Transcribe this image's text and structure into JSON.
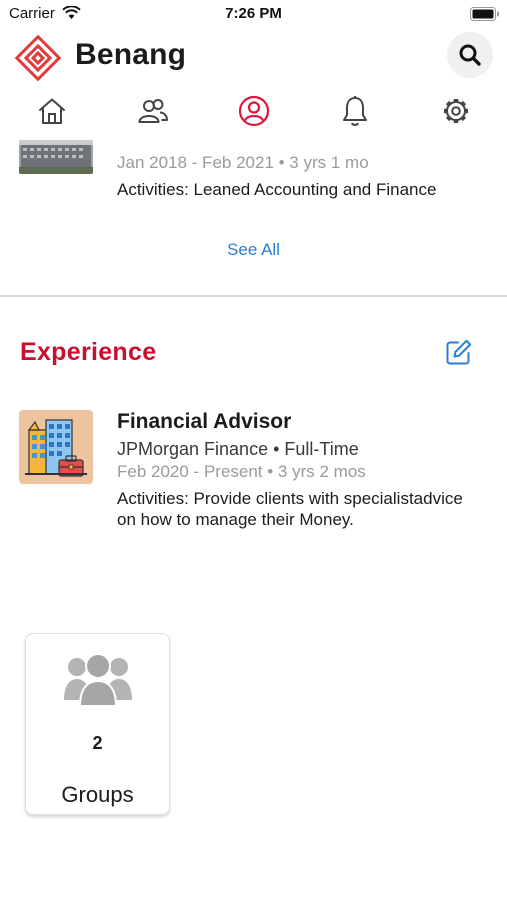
{
  "status_bar": {
    "carrier": "Carrier",
    "time": "7:26 PM"
  },
  "header": {
    "brand": "Benang",
    "search_icon": "search-icon",
    "logo_color": "#e23b3b"
  },
  "nav": {
    "items": [
      {
        "icon": "home-icon",
        "active": false
      },
      {
        "icon": "people-icon",
        "active": false
      },
      {
        "icon": "profile-icon",
        "active": true
      },
      {
        "icon": "bell-icon",
        "active": false
      },
      {
        "icon": "gear-icon",
        "active": false
      }
    ],
    "active_color": "#d81b3c",
    "inactive_color": "#444444"
  },
  "education": {
    "dates": "Jan 2018 - Feb 2021 • 3 yrs 1 mo",
    "activities": "Activities: Leaned Accounting and Finance",
    "see_all": "See All"
  },
  "experience": {
    "section_title": "Experience",
    "accent_color": "#c8102e",
    "edit_icon": "edit-icon",
    "job": {
      "title": "Financial Advisor",
      "company": "JPMorgan Finance • Full-Time",
      "dates": "Feb 2020 - Present  • 3 yrs 2 mos",
      "activities": "Activities: Provide clients with specialistadvice on how to manage their Money."
    }
  },
  "groups": {
    "count": "2",
    "label": "Groups",
    "icon": "group-icon"
  }
}
